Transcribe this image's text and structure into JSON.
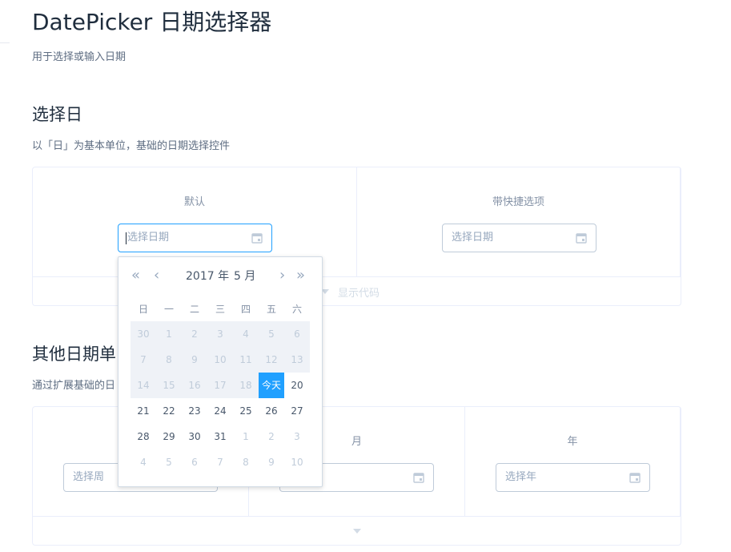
{
  "page": {
    "title": "DatePicker 日期选择器",
    "desc": "用于选择或输入日期"
  },
  "section1": {
    "title": "选择日",
    "desc": "以「日」为基本单位，基础的日期选择控件",
    "col1_label": "默认",
    "col2_label": "带快捷选项",
    "input1_placeholder": "选择日期",
    "input2_placeholder": "选择日期",
    "show_code": "显示代码"
  },
  "section2": {
    "title": "其他日期单",
    "desc": "通过扩展基础的日",
    "col2_label": "月",
    "col3_label": "年",
    "input1_placeholder": "选择周",
    "input3_placeholder": "选择年"
  },
  "picker": {
    "year_label": "2017 年",
    "month_label": "5 月",
    "nav": {
      "prev_year": "«",
      "prev_month": "‹",
      "next_month": "›",
      "next_year": "»"
    },
    "weekdays": [
      "日",
      "一",
      "二",
      "三",
      "四",
      "五",
      "六"
    ],
    "weeks": [
      [
        {
          "t": "30",
          "s": "prev"
        },
        {
          "t": "1",
          "s": "prev"
        },
        {
          "t": "2",
          "s": "prev"
        },
        {
          "t": "3",
          "s": "prev"
        },
        {
          "t": "4",
          "s": "prev"
        },
        {
          "t": "5",
          "s": "prev"
        },
        {
          "t": "6",
          "s": "prev"
        }
      ],
      [
        {
          "t": "7",
          "s": "prev"
        },
        {
          "t": "8",
          "s": "prev"
        },
        {
          "t": "9",
          "s": "prev"
        },
        {
          "t": "10",
          "s": "prev"
        },
        {
          "t": "11",
          "s": "prev"
        },
        {
          "t": "12",
          "s": "prev"
        },
        {
          "t": "13",
          "s": "prev"
        }
      ],
      [
        {
          "t": "14",
          "s": "prev"
        },
        {
          "t": "15",
          "s": "prev"
        },
        {
          "t": "16",
          "s": "prev"
        },
        {
          "t": "17",
          "s": "prev"
        },
        {
          "t": "18",
          "s": "prev"
        },
        {
          "t": "今天",
          "s": "today"
        },
        {
          "t": "20",
          "s": "cur"
        }
      ],
      [
        {
          "t": "21",
          "s": "cur"
        },
        {
          "t": "22",
          "s": "cur"
        },
        {
          "t": "23",
          "s": "cur"
        },
        {
          "t": "24",
          "s": "cur"
        },
        {
          "t": "25",
          "s": "cur"
        },
        {
          "t": "26",
          "s": "cur"
        },
        {
          "t": "27",
          "s": "cur"
        }
      ],
      [
        {
          "t": "28",
          "s": "cur"
        },
        {
          "t": "29",
          "s": "cur"
        },
        {
          "t": "30",
          "s": "cur"
        },
        {
          "t": "31",
          "s": "cur"
        },
        {
          "t": "1",
          "s": "next"
        },
        {
          "t": "2",
          "s": "next"
        },
        {
          "t": "3",
          "s": "next"
        }
      ],
      [
        {
          "t": "4",
          "s": "next"
        },
        {
          "t": "5",
          "s": "next"
        },
        {
          "t": "6",
          "s": "next"
        },
        {
          "t": "7",
          "s": "next"
        },
        {
          "t": "8",
          "s": "next"
        },
        {
          "t": "9",
          "s": "next"
        },
        {
          "t": "10",
          "s": "next"
        }
      ]
    ]
  },
  "colors": {
    "accent": "#20a0ff",
    "border": "#bfcbd9",
    "text": "#1f2d3d"
  }
}
